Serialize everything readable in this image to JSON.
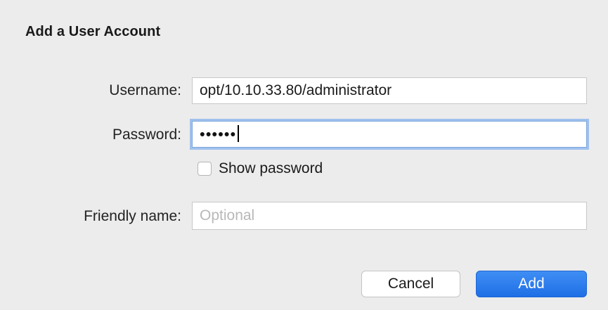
{
  "dialog": {
    "title": "Add a User Account"
  },
  "form": {
    "username_label": "Username:",
    "username_value": "opt/10.10.33.80/administrator",
    "password_label": "Password:",
    "password_masked": "••••••",
    "show_password_label": "Show password",
    "friendly_name_label": "Friendly name:",
    "friendly_name_placeholder": "Optional"
  },
  "buttons": {
    "cancel_label": "Cancel",
    "add_label": "Add"
  },
  "colors": {
    "background": "#ececec",
    "accent": "#2779ee",
    "focus_ring": "#9fc1ee"
  }
}
